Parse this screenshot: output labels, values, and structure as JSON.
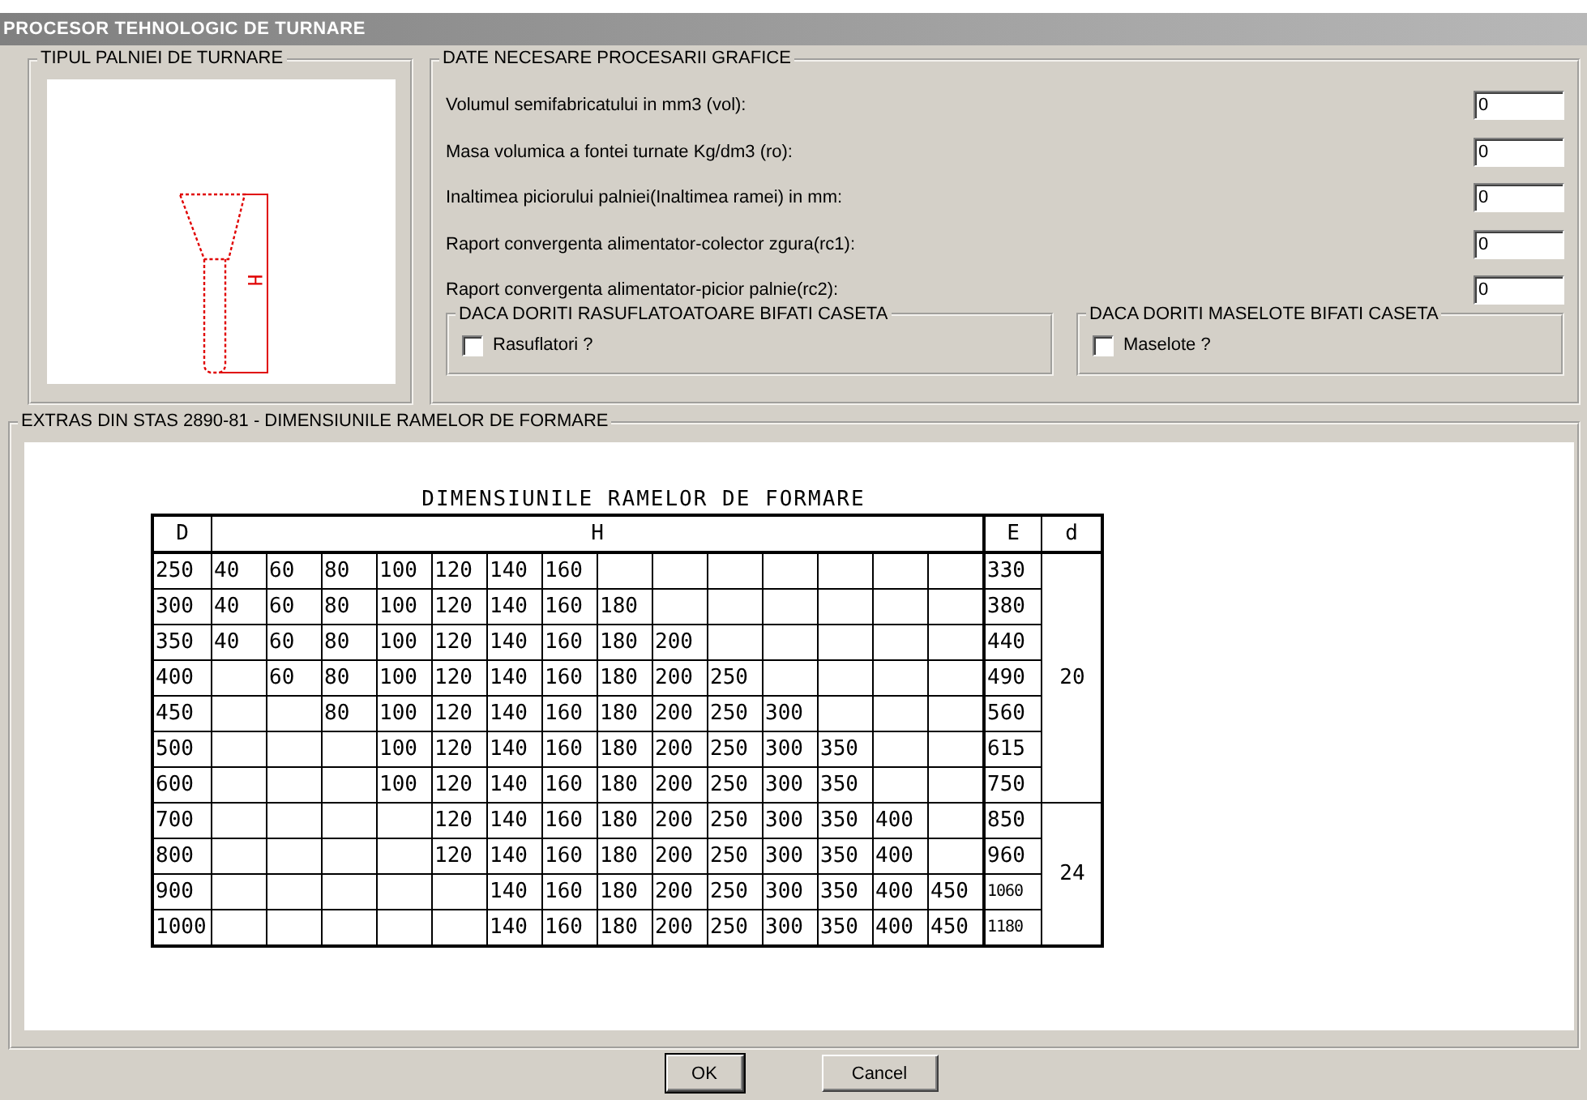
{
  "window": {
    "title": "PROCESOR TEHNOLOGIC DE TURNARE"
  },
  "funnel_panel": {
    "title": "TIPUL PALNIEI DE TURNARE",
    "dimension_label": "H"
  },
  "input_panel": {
    "title": "DATE NECESARE PROCESARII GRAFICE",
    "fields": [
      {
        "label": "Volumul semifabricatului in mm3 (vol):",
        "value": "0"
      },
      {
        "label": "Masa volumica a fontei turnate Kg/dm3 (ro):",
        "value": "0"
      },
      {
        "label": "Inaltimea piciorului palniei(Inaltimea ramei) in mm:",
        "value": "0"
      },
      {
        "label": "Raport convergenta alimentator-colector zgura(rc1):",
        "value": "0"
      },
      {
        "label": "Raport convergenta alimentator-picior palnie(rc2):",
        "value": "0"
      }
    ],
    "option_groups": [
      {
        "title": "DACA DORITI RASUFLATOATOARE BIFATI CASETA",
        "checkbox": {
          "label": "Rasuflatori ?",
          "checked": false
        }
      },
      {
        "title": "DACA DORITI MASELOTE BIFATI CASETA",
        "checkbox": {
          "label": "Maselote ?",
          "checked": false
        }
      }
    ]
  },
  "table_panel": {
    "title": "EXTRAS DIN STAS 2890-81 - DIMENSIUNILE RAMELOR DE FORMARE",
    "table": {
      "title": "DIMENSIUNILE RAMELOR DE FORMARE",
      "columns": [
        "D",
        "H",
        "E",
        "d"
      ],
      "rows": [
        {
          "D": "250",
          "H": [
            {
              "kind": "value",
              "text": "40"
            },
            {
              "kind": "value",
              "text": "60"
            },
            {
              "kind": "value",
              "text": "80"
            },
            {
              "kind": "value",
              "text": "100"
            },
            {
              "kind": "value",
              "text": "120"
            },
            {
              "kind": "value",
              "text": "140"
            },
            {
              "kind": "value",
              "text": "160"
            },
            {
              "kind": "blank"
            },
            {
              "kind": "blank"
            },
            {
              "kind": "blank"
            },
            {
              "kind": "blank"
            },
            {
              "kind": "blank"
            },
            {
              "kind": "blank"
            },
            {
              "kind": "blank"
            }
          ],
          "E": "330",
          "d": "20"
        },
        {
          "D": "300",
          "H": [
            {
              "kind": "value",
              "text": "40"
            },
            {
              "kind": "value",
              "text": "60"
            },
            {
              "kind": "value",
              "text": "80"
            },
            {
              "kind": "value",
              "text": "100"
            },
            {
              "kind": "value",
              "text": "120"
            },
            {
              "kind": "value",
              "text": "140"
            },
            {
              "kind": "value",
              "text": "160"
            },
            {
              "kind": "value",
              "text": "180"
            },
            {
              "kind": "blank"
            },
            {
              "kind": "blank"
            },
            {
              "kind": "blank"
            },
            {
              "kind": "blank"
            },
            {
              "kind": "blank"
            },
            {
              "kind": "blank"
            }
          ],
          "E": "380"
        },
        {
          "D": "350",
          "H": [
            {
              "kind": "value",
              "text": "40"
            },
            {
              "kind": "value",
              "text": "60"
            },
            {
              "kind": "value",
              "text": "80"
            },
            {
              "kind": "value",
              "text": "100"
            },
            {
              "kind": "value",
              "text": "120"
            },
            {
              "kind": "value",
              "text": "140"
            },
            {
              "kind": "value",
              "text": "160"
            },
            {
              "kind": "value",
              "text": "180"
            },
            {
              "kind": "value",
              "text": "200"
            },
            {
              "kind": "blank"
            },
            {
              "kind": "blank"
            },
            {
              "kind": "blank"
            },
            {
              "kind": "blank"
            },
            {
              "kind": "blank"
            }
          ],
          "E": "440"
        },
        {
          "D": "400",
          "H": [
            {
              "kind": "blank"
            },
            {
              "kind": "value",
              "text": "60"
            },
            {
              "kind": "value",
              "text": "80"
            },
            {
              "kind": "value",
              "text": "100"
            },
            {
              "kind": "value",
              "text": "120"
            },
            {
              "kind": "value",
              "text": "140"
            },
            {
              "kind": "value",
              "text": "160"
            },
            {
              "kind": "value",
              "text": "180"
            },
            {
              "kind": "value",
              "text": "200"
            },
            {
              "kind": "value",
              "text": "250"
            },
            {
              "kind": "blank"
            },
            {
              "kind": "blank"
            },
            {
              "kind": "blank"
            },
            {
              "kind": "blank"
            }
          ],
          "E": "490"
        },
        {
          "D": "450",
          "H": [
            {
              "kind": "blank"
            },
            {
              "kind": "blank"
            },
            {
              "kind": "value",
              "text": "80"
            },
            {
              "kind": "value",
              "text": "100"
            },
            {
              "kind": "value",
              "text": "120"
            },
            {
              "kind": "value",
              "text": "140"
            },
            {
              "kind": "value",
              "text": "160"
            },
            {
              "kind": "value",
              "text": "180"
            },
            {
              "kind": "value",
              "text": "200"
            },
            {
              "kind": "value",
              "text": "250"
            },
            {
              "kind": "value",
              "text": "300"
            },
            {
              "kind": "blank"
            },
            {
              "kind": "blank"
            },
            {
              "kind": "blank"
            }
          ],
          "E": "560"
        },
        {
          "D": "500",
          "H": [
            {
              "kind": "blank"
            },
            {
              "kind": "blank"
            },
            {
              "kind": "blank"
            },
            {
              "kind": "value",
              "text": "100"
            },
            {
              "kind": "value",
              "text": "120"
            },
            {
              "kind": "value",
              "text": "140"
            },
            {
              "kind": "value",
              "text": "160"
            },
            {
              "kind": "value",
              "text": "180"
            },
            {
              "kind": "value",
              "text": "200"
            },
            {
              "kind": "value",
              "text": "250"
            },
            {
              "kind": "value",
              "text": "300"
            },
            {
              "kind": "value",
              "text": "350"
            },
            {
              "kind": "blank"
            },
            {
              "kind": "blank"
            }
          ],
          "E": "615"
        },
        {
          "D": "600",
          "H": [
            {
              "kind": "blank"
            },
            {
              "kind": "blank"
            },
            {
              "kind": "blank"
            },
            {
              "kind": "value",
              "text": "100"
            },
            {
              "kind": "value",
              "text": "120"
            },
            {
              "kind": "value",
              "text": "140"
            },
            {
              "kind": "value",
              "text": "160"
            },
            {
              "kind": "value",
              "text": "180"
            },
            {
              "kind": "value",
              "text": "200"
            },
            {
              "kind": "value",
              "text": "250"
            },
            {
              "kind": "value",
              "text": "300"
            },
            {
              "kind": "value",
              "text": "350"
            },
            {
              "kind": "blank"
            },
            {
              "kind": "blank"
            }
          ],
          "E": "750"
        },
        {
          "D": "700",
          "H": [
            {
              "kind": "blank"
            },
            {
              "kind": "blank"
            },
            {
              "kind": "blank"
            },
            {
              "kind": "blank"
            },
            {
              "kind": "value",
              "text": "120"
            },
            {
              "kind": "value",
              "text": "140"
            },
            {
              "kind": "value",
              "text": "160"
            },
            {
              "kind": "value",
              "text": "180"
            },
            {
              "kind": "value",
              "text": "200"
            },
            {
              "kind": "value",
              "text": "250"
            },
            {
              "kind": "value",
              "text": "300"
            },
            {
              "kind": "value",
              "text": "350"
            },
            {
              "kind": "value",
              "text": "400"
            },
            {
              "kind": "blank"
            }
          ],
          "E": "850",
          "d": "24"
        },
        {
          "D": "800",
          "H": [
            {
              "kind": "blank"
            },
            {
              "kind": "blank"
            },
            {
              "kind": "blank"
            },
            {
              "kind": "blank"
            },
            {
              "kind": "value",
              "text": "120"
            },
            {
              "kind": "value",
              "text": "140"
            },
            {
              "kind": "value",
              "text": "160"
            },
            {
              "kind": "value",
              "text": "180"
            },
            {
              "kind": "value",
              "text": "200"
            },
            {
              "kind": "value",
              "text": "250"
            },
            {
              "kind": "value",
              "text": "300"
            },
            {
              "kind": "value",
              "text": "350"
            },
            {
              "kind": "value",
              "text": "400"
            },
            {
              "kind": "blank"
            }
          ],
          "E": "960"
        },
        {
          "D": "900",
          "H": [
            {
              "kind": "blank"
            },
            {
              "kind": "blank"
            },
            {
              "kind": "blank"
            },
            {
              "kind": "blank"
            },
            {
              "kind": "blank"
            },
            {
              "kind": "value",
              "text": "140"
            },
            {
              "kind": "value",
              "text": "160"
            },
            {
              "kind": "value",
              "text": "180"
            },
            {
              "kind": "value",
              "text": "200"
            },
            {
              "kind": "value",
              "text": "250"
            },
            {
              "kind": "value",
              "text": "300"
            },
            {
              "kind": "value",
              "text": "350"
            },
            {
              "kind": "value",
              "text": "400"
            },
            {
              "kind": "value",
              "text": "450"
            }
          ],
          "E": "1060"
        },
        {
          "D": "1000",
          "H": [
            {
              "kind": "blank"
            },
            {
              "kind": "blank"
            },
            {
              "kind": "blank"
            },
            {
              "kind": "blank"
            },
            {
              "kind": "blank"
            },
            {
              "kind": "value",
              "text": "140"
            },
            {
              "kind": "value",
              "text": "160"
            },
            {
              "kind": "value",
              "text": "180"
            },
            {
              "kind": "value",
              "text": "200"
            },
            {
              "kind": "value",
              "text": "250"
            },
            {
              "kind": "value",
              "text": "300"
            },
            {
              "kind": "value",
              "text": "350"
            },
            {
              "kind": "value",
              "text": "400"
            },
            {
              "kind": "value",
              "text": "450"
            }
          ],
          "E": "1180"
        }
      ]
    }
  },
  "buttons": [
    "OK",
    "Cancel"
  ]
}
